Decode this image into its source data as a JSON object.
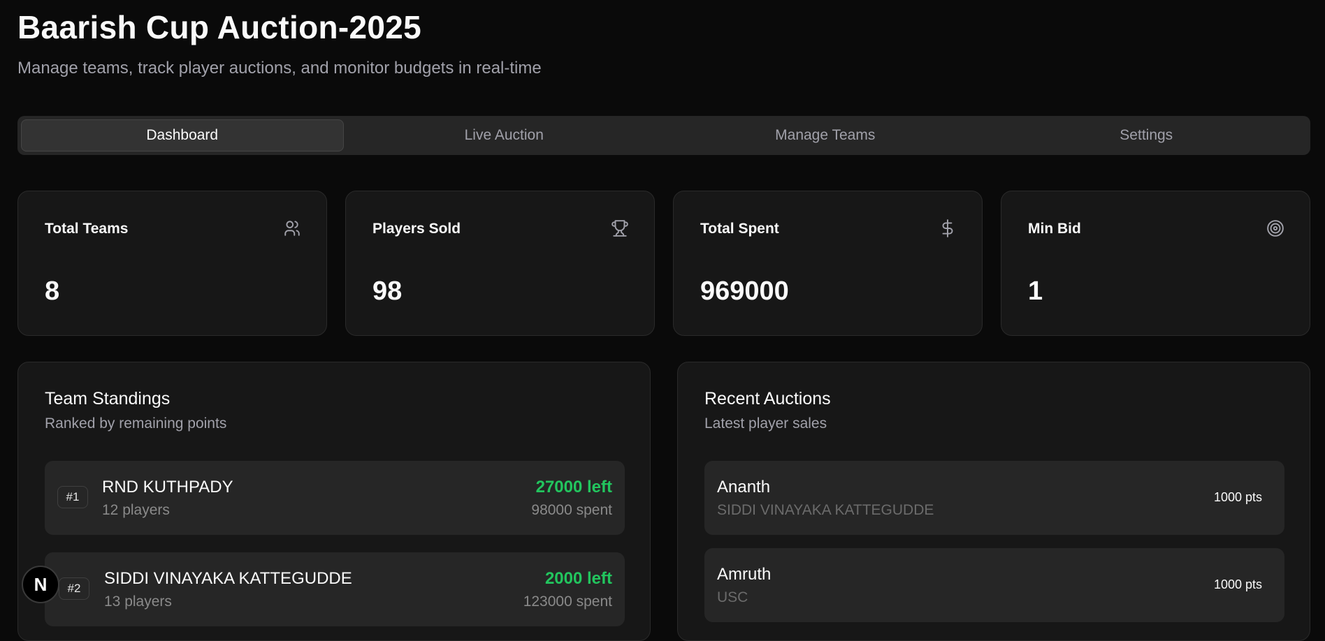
{
  "header": {
    "title": "Baarish Cup Auction-2025",
    "subtitle": "Manage teams, track player auctions, and monitor budgets in real-time"
  },
  "tabs": [
    {
      "label": "Dashboard",
      "active": true
    },
    {
      "label": "Live Auction",
      "active": false
    },
    {
      "label": "Manage Teams",
      "active": false
    },
    {
      "label": "Settings",
      "active": false
    }
  ],
  "stats": [
    {
      "label": "Total Teams",
      "value": "8",
      "icon": "users-icon"
    },
    {
      "label": "Players Sold",
      "value": "98",
      "icon": "trophy-icon"
    },
    {
      "label": "Total Spent",
      "value": "969000",
      "icon": "dollar-icon"
    },
    {
      "label": "Min Bid",
      "value": "1",
      "icon": "target-icon"
    }
  ],
  "standings": {
    "title": "Team Standings",
    "subtitle": "Ranked by remaining points",
    "rows": [
      {
        "rank": "#1",
        "name": "RND KUTHPADY",
        "players": "12 players",
        "left": "27000 left",
        "spent": "98000 spent"
      },
      {
        "rank": "#2",
        "name": "SIDDI VINAYAKA KATTEGUDDE",
        "players": "13 players",
        "left": "2000 left",
        "spent": "123000 spent"
      }
    ]
  },
  "recent": {
    "title": "Recent Auctions",
    "subtitle": "Latest player sales",
    "rows": [
      {
        "player": "Ananth",
        "team": "SIDDI VINAYAKA KATTEGUDDE",
        "points": "1000 pts"
      },
      {
        "player": "Amruth",
        "team": "USC",
        "points": "1000 pts"
      }
    ]
  },
  "colors": {
    "background": "#0a0a0a",
    "card": "#171717",
    "accent_green": "#22c55e"
  },
  "dev_badge": {
    "label": "N"
  }
}
